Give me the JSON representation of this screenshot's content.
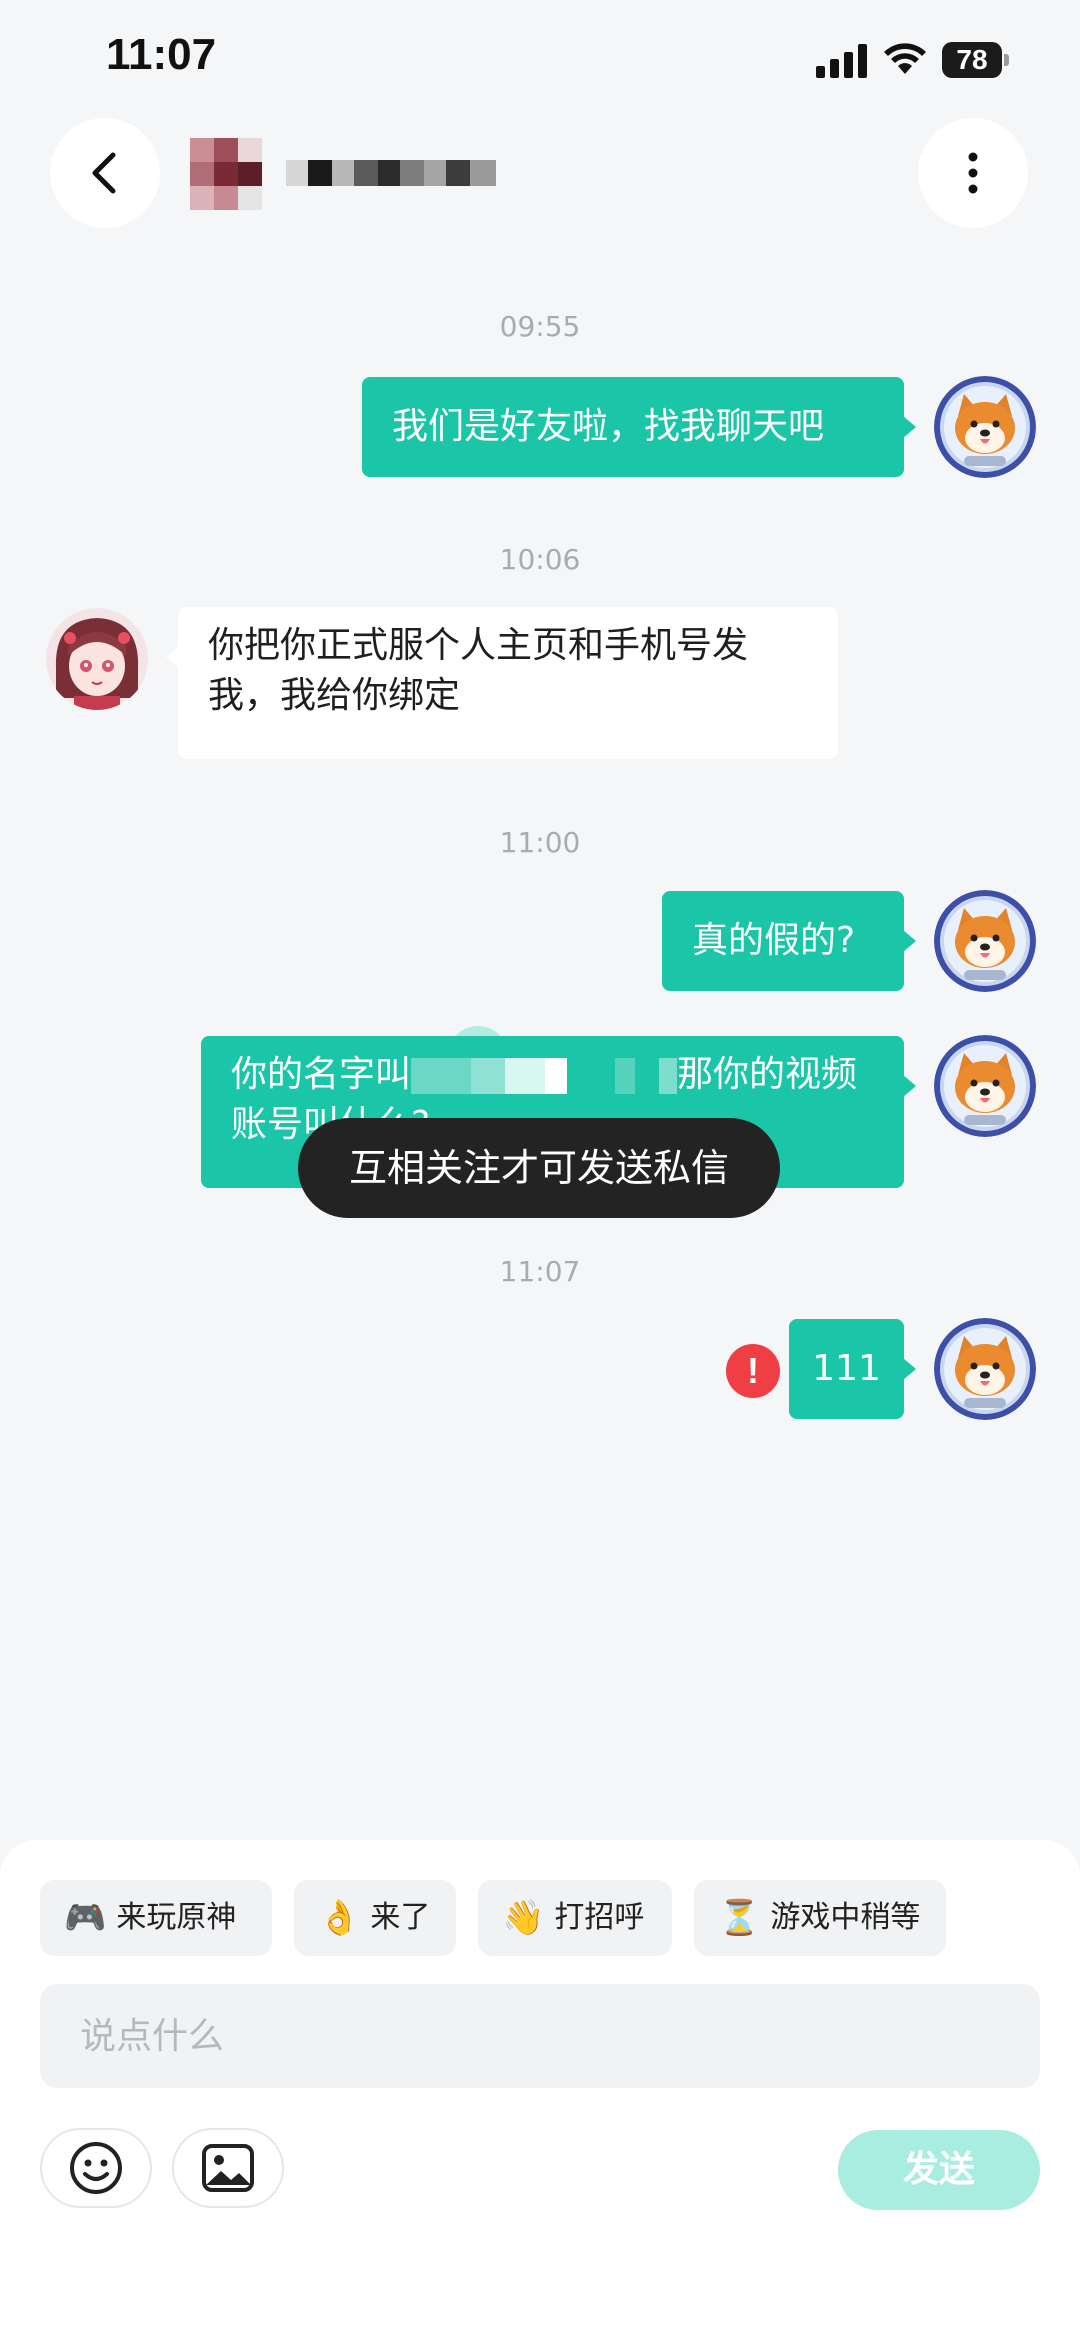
{
  "status_bar": {
    "time": "11:07",
    "battery_level": "78",
    "icons": [
      "signal-icon",
      "wifi-icon",
      "battery-icon"
    ]
  },
  "header": {
    "back_icon": "chevron-left-icon",
    "more_icon": "more-vertical-icon"
  },
  "messages": [
    {
      "timestamp": "09:55",
      "direction": "outgoing",
      "text": "我们是好友啦，找我聊天吧"
    },
    {
      "timestamp": "10:06",
      "direction": "incoming",
      "text": "你把你正式服个人主页和手机号发我，我给你绑定"
    },
    {
      "timestamp": "11:00",
      "direction": "outgoing",
      "text": "真的假的?"
    },
    {
      "direction": "outgoing",
      "text_part1": "你的名字叫",
      "text_part2": "那你的视频",
      "text_part3": "账号叫什么?"
    },
    {
      "timestamp": "11:07",
      "direction": "outgoing",
      "text": "111",
      "status": "failed",
      "status_icon": "error-icon"
    }
  ],
  "toast": {
    "text": "互相关注才可发送私信"
  },
  "quick_replies": [
    {
      "icon": "🎮",
      "label": "来玩原神"
    },
    {
      "icon": "👌",
      "label": "来了"
    },
    {
      "icon": "👋",
      "label": "打招呼"
    },
    {
      "icon": "⏳",
      "label": "游戏中稍等"
    }
  ],
  "composer": {
    "placeholder": "说点什么",
    "value": "",
    "send_label": "发送",
    "emoji_icon": "emoji-icon",
    "image_icon": "image-icon"
  },
  "colors": {
    "accent": "#1ac6a7",
    "send_disabled": "#a9ece0",
    "error": "#ef3f45",
    "background": "#f5f6f8"
  }
}
